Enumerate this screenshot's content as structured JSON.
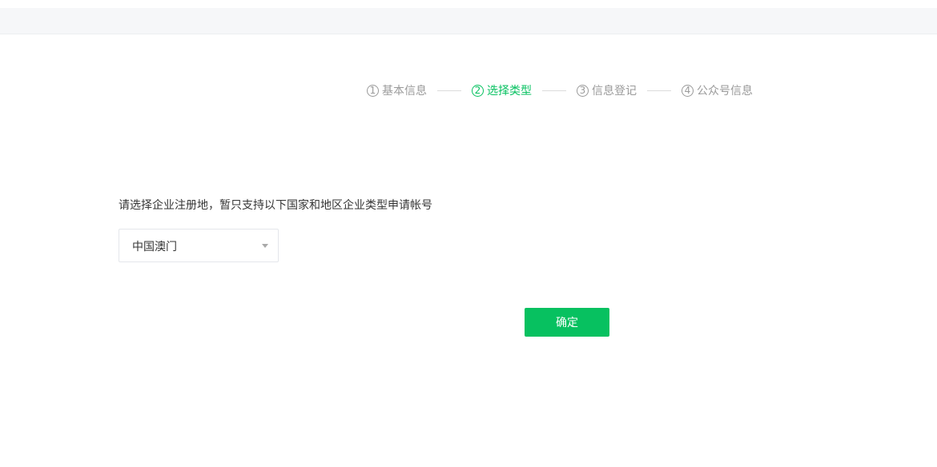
{
  "steps": [
    {
      "number": "1",
      "label": "基本信息"
    },
    {
      "number": "2",
      "label": "选择类型"
    },
    {
      "number": "3",
      "label": "信息登记"
    },
    {
      "number": "4",
      "label": "公众号信息"
    }
  ],
  "active_step": 2,
  "prompt": "请选择企业注册地，暂只支持以下国家和地区企业类型申请帐号",
  "region_select": {
    "selected": "中国澳门"
  },
  "confirm_button": {
    "label": "确定"
  },
  "colors": {
    "accent": "#07c160",
    "muted": "#9a9a9a",
    "text": "#353535"
  },
  "icons": {
    "dropdown": "chevron-down-icon"
  }
}
